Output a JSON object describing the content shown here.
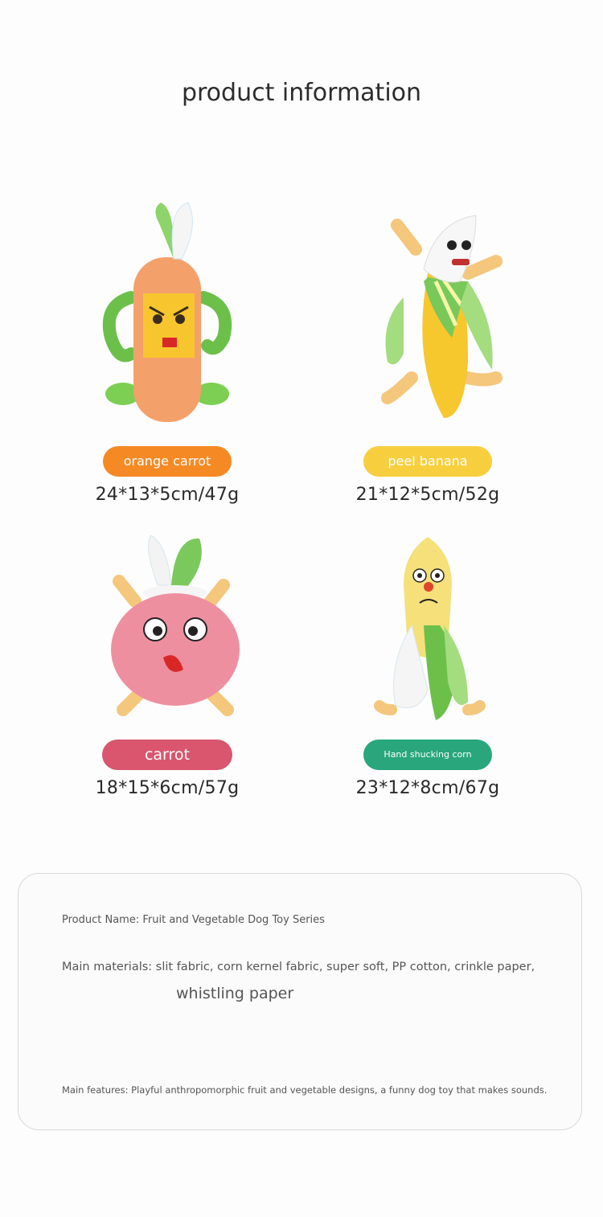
{
  "page": {
    "title": "product information"
  },
  "products": [
    {
      "name": "orange carrot",
      "size": "24*13*5cm/47g",
      "color": "#f58a25",
      "illustration": "carrot-toy"
    },
    {
      "name": "peel banana",
      "size": "21*12*5cm/52g",
      "color": "#f7cf3e",
      "illustration": "banana-toy"
    },
    {
      "name": "carrot",
      "size": "18*15*6cm/57g",
      "color": "#d9566e",
      "illustration": "radish-toy"
    },
    {
      "name": "Hand shucking corn",
      "size": "23*12*8cm/67g",
      "color": "#29a67b",
      "illustration": "corn-toy"
    }
  ],
  "info": {
    "product_name": "Product Name: Fruit and Vegetable Dog Toy Series",
    "materials_line1": "Main materials: slit fabric, corn kernel fabric, super soft, PP cotton, crinkle paper,",
    "materials_line2": "whistling paper",
    "features": "Main features: Playful anthropomorphic fruit and vegetable designs, a funny dog toy that makes sounds."
  }
}
